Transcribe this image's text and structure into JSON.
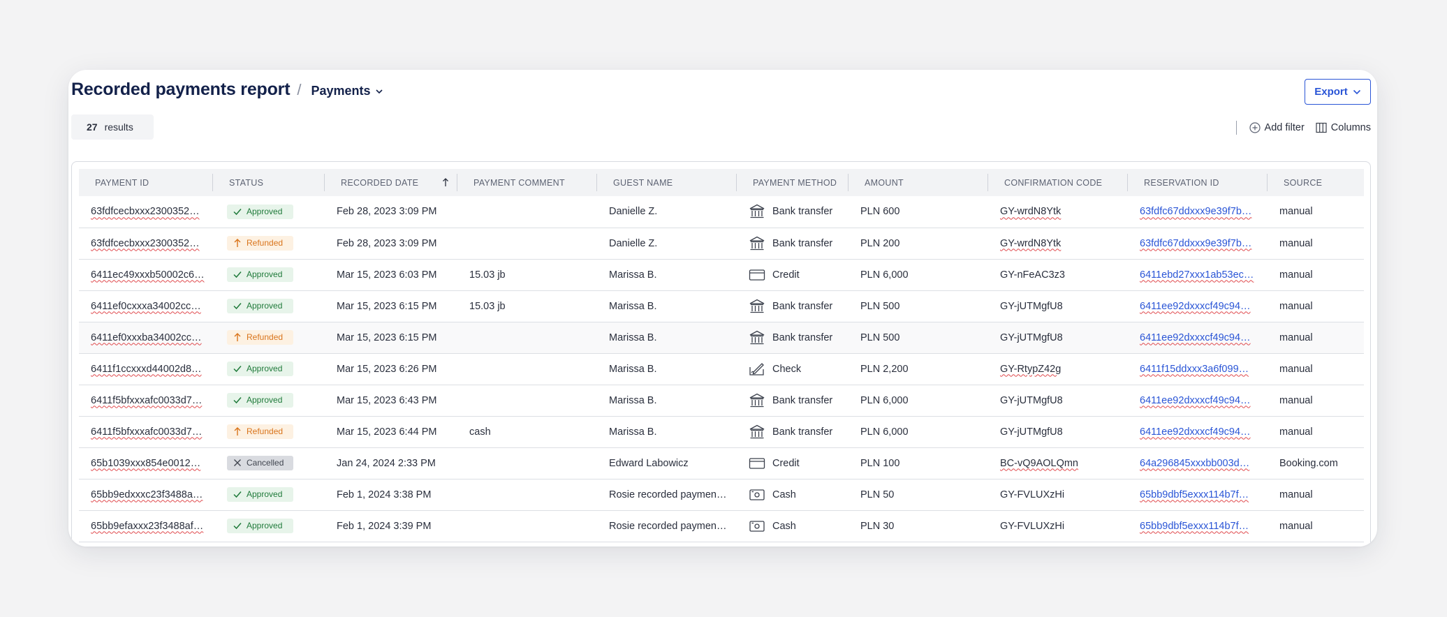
{
  "header": {
    "title": "Recorded payments report",
    "separator": "/",
    "view_label": "Payments",
    "export_label": "Export"
  },
  "results": {
    "count": "27",
    "label": "results"
  },
  "tools": {
    "add_filter": "Add filter",
    "columns": "Columns"
  },
  "colors": {
    "accent": "#2a55d6",
    "title": "#13214a",
    "approved": "#1f7a3a",
    "refunded": "#d9741b",
    "cancelled": "#40454f"
  },
  "table": {
    "columns": [
      "PAYMENT ID",
      "STATUS",
      "RECORDED DATE",
      "PAYMENT COMMENT",
      "GUEST NAME",
      "PAYMENT METHOD",
      "AMOUNT",
      "CONFIRMATION CODE",
      "RESERVATION ID",
      "SOURCE"
    ],
    "sort_column": "RECORDED DATE",
    "rows": [
      {
        "payment_id": "63fdfcecbxxx2300352…",
        "status": "Approved",
        "status_icon": "check-icon",
        "date": "Feb 28, 2023 3:09 PM",
        "comment": "",
        "guest": "Danielle Z.",
        "method": "Bank transfer",
        "method_icon": "bank-icon",
        "amount": "PLN 600",
        "confirmation": "GY-wrdN8Ytk",
        "reservation": "63fdfc67ddxxx9e39f7b…",
        "source": "manual"
      },
      {
        "payment_id": "63fdfcecbxxx2300352…",
        "status": "Refunded",
        "status_icon": "refund-arrow-icon",
        "date": "Feb 28, 2023 3:09 PM",
        "comment": "",
        "guest": "Danielle Z.",
        "method": "Bank transfer",
        "method_icon": "bank-icon",
        "amount": "PLN 200",
        "confirmation": "GY-wrdN8Ytk",
        "reservation": "63fdfc67ddxxx9e39f7b…",
        "source": "manual"
      },
      {
        "payment_id": "6411ec49xxxb50002c6…",
        "status": "Approved",
        "status_icon": "check-icon",
        "date": "Mar 15, 2023 6:03 PM",
        "comment": "15.03 jb",
        "guest": "Marissa B.",
        "method": "Credit",
        "method_icon": "credit-card-icon",
        "amount": "PLN 6,000",
        "confirmation": "GY-nFeAC3z3",
        "reservation": "6411ebd27xxx1ab53ec…",
        "source": "manual"
      },
      {
        "payment_id": "6411ef0cxxxa34002cc…",
        "status": "Approved",
        "status_icon": "check-icon",
        "date": "Mar 15, 2023 6:15 PM",
        "comment": "15.03 jb",
        "guest": "Marissa B.",
        "method": "Bank transfer",
        "method_icon": "bank-icon",
        "amount": "PLN 500",
        "confirmation": "GY-jUTMgfU8",
        "reservation": "6411ee92dxxxcf49c94…",
        "source": "manual"
      },
      {
        "payment_id": "6411ef0xxxba34002cc…",
        "status": "Refunded",
        "status_icon": "refund-arrow-icon",
        "date": "Mar 15, 2023 6:15 PM",
        "comment": "",
        "guest": "Marissa B.",
        "method": "Bank transfer",
        "method_icon": "bank-icon",
        "amount": "PLN 500",
        "confirmation": "GY-jUTMgfU8",
        "reservation": "6411ee92dxxxcf49c94…",
        "source": "manual"
      },
      {
        "payment_id": "6411f1ccxxxd44002d8…",
        "status": "Approved",
        "status_icon": "check-icon",
        "date": "Mar 15, 2023 6:26 PM",
        "comment": "",
        "guest": "Marissa B.",
        "method": "Check",
        "method_icon": "check-pen-icon",
        "amount": "PLN 2,200",
        "confirmation": "GY-RtypZ42g",
        "reservation": "6411f15ddxxx3a6f099…",
        "source": "manual"
      },
      {
        "payment_id": "6411f5bfxxxafc0033d7…",
        "status": "Approved",
        "status_icon": "check-icon",
        "date": "Mar 15, 2023 6:43 PM",
        "comment": "",
        "guest": "Marissa B.",
        "method": "Bank transfer",
        "method_icon": "bank-icon",
        "amount": "PLN 6,000",
        "confirmation": "GY-jUTMgfU8",
        "reservation": "6411ee92dxxxcf49c94…",
        "source": "manual"
      },
      {
        "payment_id": "6411f5bfxxxafc0033d7…",
        "status": "Refunded",
        "status_icon": "refund-arrow-icon",
        "date": "Mar 15, 2023 6:44 PM",
        "comment": "cash",
        "guest": "Marissa B.",
        "method": "Bank transfer",
        "method_icon": "bank-icon",
        "amount": "PLN 6,000",
        "confirmation": "GY-jUTMgfU8",
        "reservation": "6411ee92dxxxcf49c94…",
        "source": "manual"
      },
      {
        "payment_id": "65b1039xxx854e0012…",
        "status": "Cancelled",
        "status_icon": "x-icon",
        "date": "Jan 24, 2024 2:33 PM",
        "comment": "",
        "guest": "Edward Labowicz",
        "method": "Credit",
        "method_icon": "credit-card-icon",
        "amount": "PLN 100",
        "confirmation": "BC-vQ9AOLQmn",
        "reservation": "64a296845xxxbb003d…",
        "source": "Booking.com"
      },
      {
        "payment_id": "65bb9edxxxc23f3488a…",
        "status": "Approved",
        "status_icon": "check-icon",
        "date": "Feb 1, 2024 3:38 PM",
        "comment": "",
        "guest": "Rosie  recorded paymen…",
        "method": "Cash",
        "method_icon": "cash-icon",
        "amount": "PLN 50",
        "confirmation": "GY-FVLUXzHi",
        "reservation": "65bb9dbf5exxx114b7f…",
        "source": "manual"
      },
      {
        "payment_id": "65bb9efaxxx23f3488af…",
        "status": "Approved",
        "status_icon": "check-icon",
        "date": "Feb 1, 2024 3:39 PM",
        "comment": "",
        "guest": "Rosie  recorded paymen…",
        "method": "Cash",
        "method_icon": "cash-icon",
        "amount": "PLN 30",
        "confirmation": "GY-FVLUXzHi",
        "reservation": "65bb9dbf5exxx114b7f…",
        "source": "manual"
      }
    ]
  }
}
